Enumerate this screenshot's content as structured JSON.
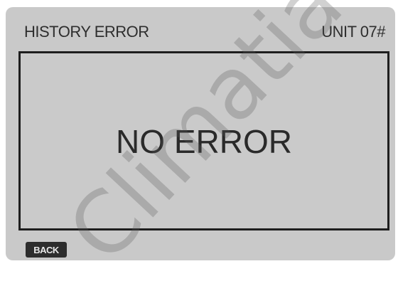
{
  "header": {
    "title": "HISTORY ERROR",
    "unit": "UNIT 07#"
  },
  "panel": {
    "message": "NO ERROR"
  },
  "footer": {
    "back_label": "BACK"
  },
  "watermark": {
    "text": "Climatia"
  },
  "colors": {
    "screen_background": "#c9c9c9",
    "text": "#2e2e2e",
    "border": "#1e1e1e",
    "button_background": "#2d2d2d"
  }
}
